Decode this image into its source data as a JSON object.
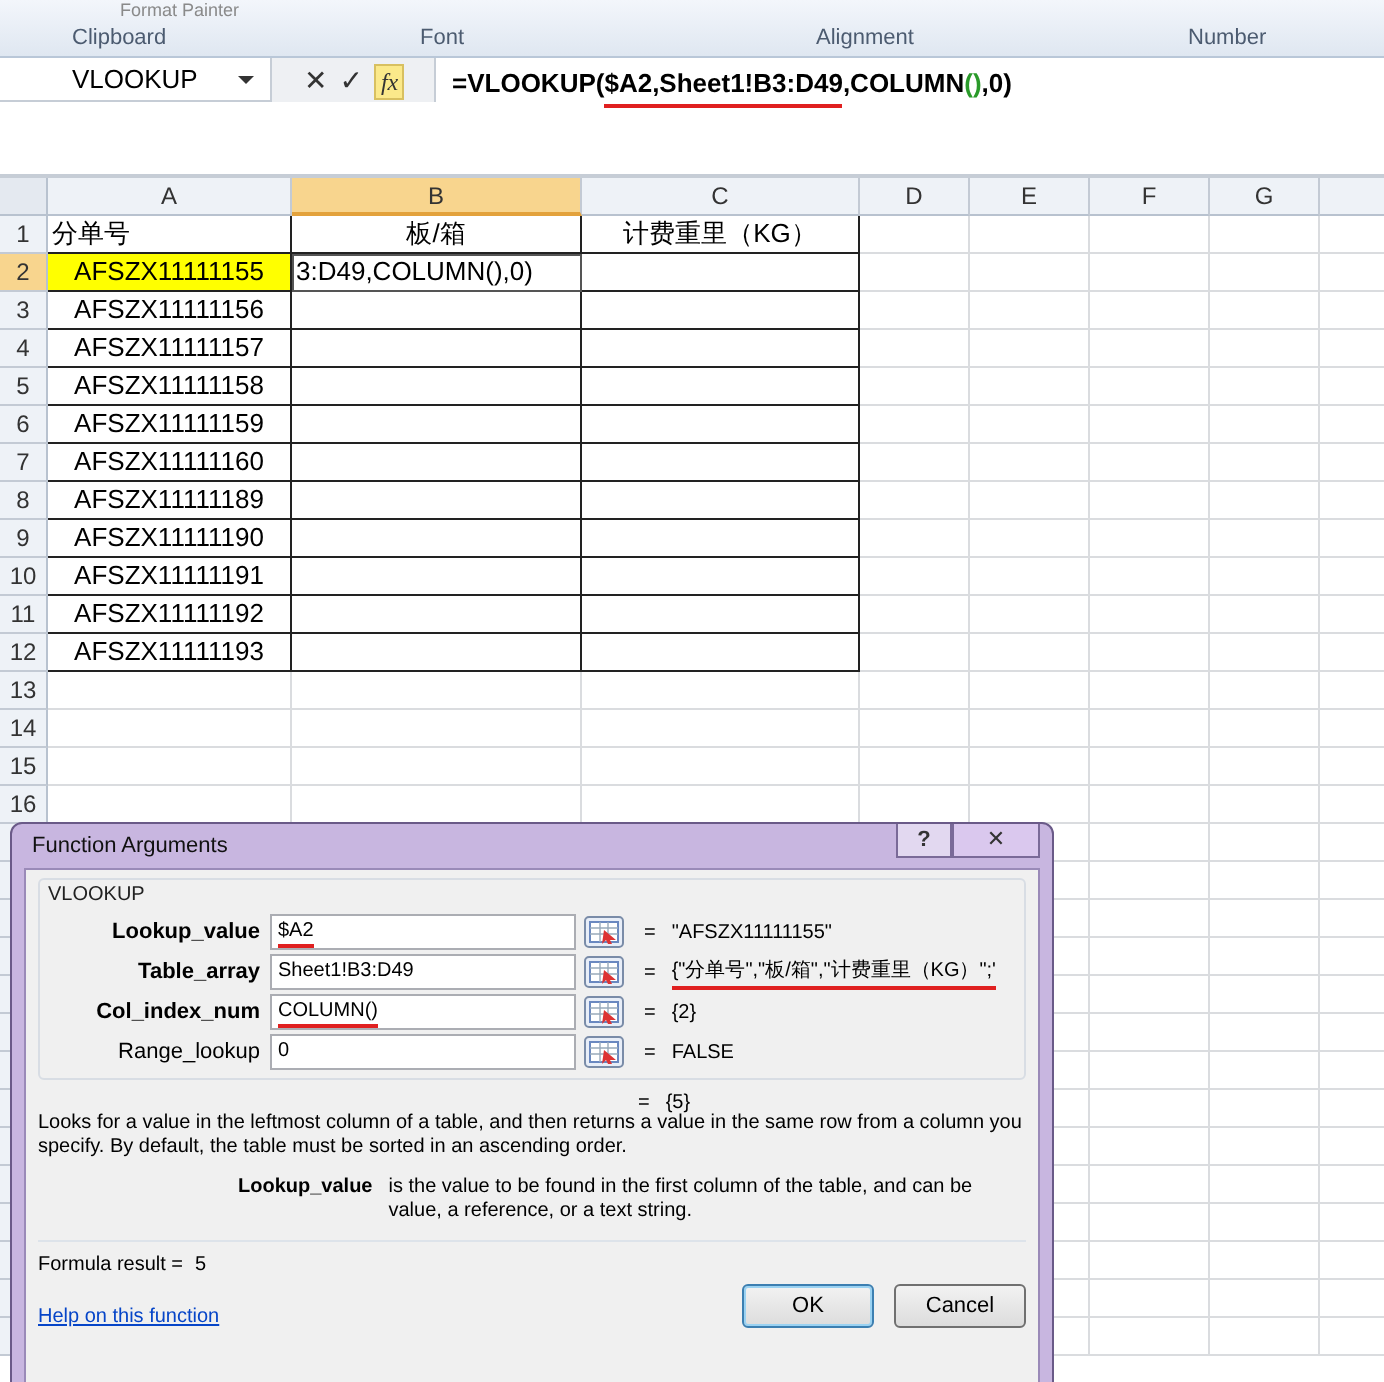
{
  "ribbon": {
    "cut_label": "Format Painter",
    "groups": [
      "Clipboard",
      "Font",
      "Alignment",
      "Number"
    ]
  },
  "formula_bar": {
    "name_box": "VLOOKUP",
    "cancel": "✕",
    "enter": "✓",
    "function": "fx",
    "formula": [
      {
        "text": "=VLOOKUP(",
        "kind": "plain"
      },
      {
        "text": "$A2,Sheet1!B3:D49",
        "kind": "underlined"
      },
      {
        "text": ",COLUMN",
        "kind": "plain"
      },
      {
        "text": "()",
        "kind": "paren"
      },
      {
        "text": ",0)",
        "kind": "plain"
      }
    ]
  },
  "sheet": {
    "columns": [
      {
        "label": "A",
        "selected": false
      },
      {
        "label": "B",
        "selected": true
      },
      {
        "label": "C",
        "selected": false
      },
      {
        "label": "D",
        "selected": false
      },
      {
        "label": "E",
        "selected": false
      },
      {
        "label": "F",
        "selected": false
      },
      {
        "label": "G",
        "selected": false
      }
    ],
    "rows": [
      {
        "number": "1",
        "selected": false,
        "cells": [
          "分单号",
          "板/箱",
          "计费重里（KG）"
        ]
      },
      {
        "number": "2",
        "selected": true,
        "cells": [
          "AFSZX11111155",
          "3:D49,COLUMN(),0)",
          ""
        ]
      },
      {
        "number": "3",
        "selected": false,
        "cells": [
          "AFSZX11111156",
          "",
          ""
        ]
      },
      {
        "number": "4",
        "selected": false,
        "cells": [
          "AFSZX11111157",
          "",
          ""
        ]
      },
      {
        "number": "5",
        "selected": false,
        "cells": [
          "AFSZX11111158",
          "",
          ""
        ]
      },
      {
        "number": "6",
        "selected": false,
        "cells": [
          "AFSZX11111159",
          "",
          ""
        ]
      },
      {
        "number": "7",
        "selected": false,
        "cells": [
          "AFSZX11111160",
          "",
          ""
        ]
      },
      {
        "number": "8",
        "selected": false,
        "cells": [
          "AFSZX11111189",
          "",
          ""
        ]
      },
      {
        "number": "9",
        "selected": false,
        "cells": [
          "AFSZX11111190",
          "",
          ""
        ]
      },
      {
        "number": "10",
        "selected": false,
        "cells": [
          "AFSZX11111191",
          "",
          ""
        ]
      },
      {
        "number": "11",
        "selected": false,
        "cells": [
          "AFSZX11111192",
          "",
          ""
        ]
      },
      {
        "number": "12",
        "selected": false,
        "cells": [
          "AFSZX11111193",
          "",
          ""
        ]
      },
      {
        "number": "13",
        "selected": false,
        "cells": [
          "",
          "",
          ""
        ]
      },
      {
        "number": "14",
        "selected": false,
        "cells": [
          "",
          "",
          ""
        ]
      },
      {
        "number": "15",
        "selected": false,
        "cells": [
          "",
          "",
          ""
        ]
      },
      {
        "number": "16",
        "selected": false,
        "cells": [
          "",
          "",
          ""
        ]
      }
    ]
  },
  "dialog": {
    "title": "Function Arguments",
    "help": "?",
    "close": "✕",
    "function": "VLOOKUP",
    "arguments": [
      {
        "label": "Lookup_value",
        "required": true,
        "value": "$A2",
        "value_marked": true,
        "result": "\"AFSZX11111155\"",
        "result_marked": false
      },
      {
        "label": "Table_array",
        "required": true,
        "value": "Sheet1!B3:D49",
        "value_marked": false,
        "result": "{\"分单号\",\"板/箱\",\"计费重里（KG）\";'",
        "result_marked": true
      },
      {
        "label": "Col_index_num",
        "required": true,
        "value": "COLUMN()",
        "value_marked": true,
        "result": "{2}",
        "result_marked": false
      },
      {
        "label": "Range_lookup",
        "required": false,
        "value": "0",
        "value_marked": false,
        "result": "FALSE",
        "result_marked": false
      }
    ],
    "equals": "=",
    "overall_result": "{5}",
    "description": "Looks for a value in the leftmost column of a table, and then returns a value in the same row from a column you specify. By default, the table must be sorted in an ascending order.",
    "argument_name": "Lookup_value",
    "argument_help": "is the value to be found in the first column of the table, and can be value, a reference, or a text string.",
    "formula_result_label": "Formula result =",
    "formula_result": "5",
    "help_link": "Help on this function",
    "buttons": [
      {
        "label": "OK",
        "default": true
      },
      {
        "label": "Cancel",
        "default": false
      }
    ]
  }
}
